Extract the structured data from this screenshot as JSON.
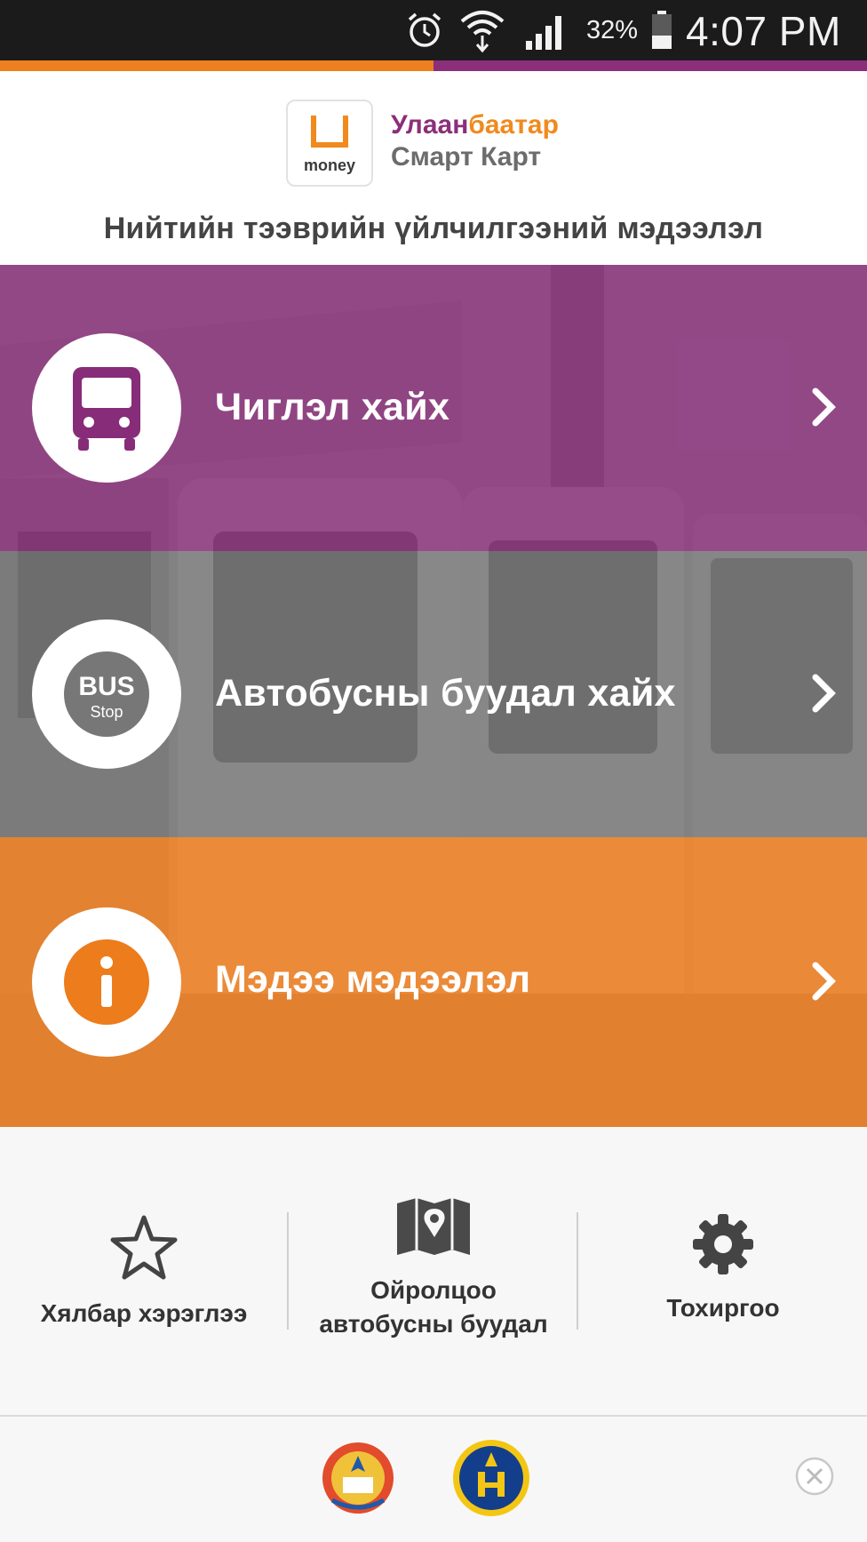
{
  "status_bar": {
    "battery_percent": "32%",
    "time": "4:07 PM",
    "icons": [
      "alarm-icon",
      "wifi-icon",
      "signal-icon",
      "battery-icon"
    ]
  },
  "progress": {
    "fraction": 0.5
  },
  "header": {
    "logo_word": "money",
    "brand_part1": "Улаан",
    "brand_part2": "баатар",
    "brand_line2": "Смарт Карт",
    "subtitle": "Нийтийн тээврийн үйлчилгээний мэдээлэл"
  },
  "menu": {
    "items": [
      {
        "label": "Чиглэл хайх",
        "icon": "bus-icon",
        "color": "#872c78"
      },
      {
        "label": "Автобусны буудал хайх",
        "icon": "bus-stop-icon",
        "icon_text_1": "BUS",
        "icon_text_2": "Stop",
        "color": "#6e6e6e"
      },
      {
        "label": "Мэдээ мэдээлэл",
        "icon": "info-icon",
        "color": "#ec7c1c"
      }
    ]
  },
  "toolbar": {
    "items": [
      {
        "label": "Хялбар хэрэглээ",
        "icon": "star-icon"
      },
      {
        "label_line1": "Ойролцоо",
        "label_line2": "автобусны буудал",
        "icon": "map-pin-icon"
      },
      {
        "label": "Тохиргоо",
        "icon": "gear-icon"
      }
    ]
  },
  "footer": {
    "icons": [
      "state-emblem-icon",
      "seal-logo-icon",
      "close-icon"
    ]
  },
  "colors": {
    "purple": "#872c78",
    "orange": "#ec7c1c",
    "gray": "#6e6e6e",
    "status_bar": "#1b1b1b"
  }
}
